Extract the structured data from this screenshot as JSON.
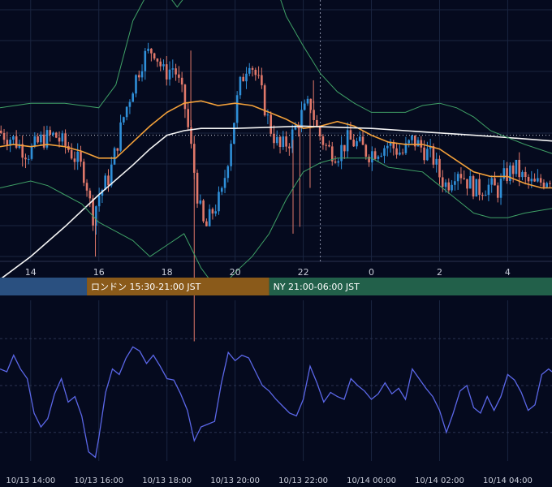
{
  "colors": {
    "background": "#050a1e",
    "grid": "#1a2540",
    "candle_up": "#2f8fd8",
    "candle_down": "#e0786a",
    "sma_short": "#f2a03a",
    "sma_long": "#f4f4f4",
    "bollinger": "#3fa066",
    "oscillator": "#5b67e8",
    "session_tokyo": "#2a5080",
    "session_london": "#8a5a1a",
    "session_ny": "#22604a"
  },
  "chart_data": [
    {
      "type": "candlestick",
      "x_tick_labels": [
        "14",
        "16",
        "18",
        "20",
        "22",
        "0",
        "2",
        "4"
      ],
      "x_tick_hours": [
        14,
        16,
        18,
        20,
        22,
        24,
        26,
        28
      ],
      "xlim_hours": [
        13.1,
        29.3
      ],
      "ylim": [
        0,
        1
      ],
      "grid": true,
      "series": [
        {
          "kind": "sma_short",
          "points": [
            [
              13.1,
              0.43
            ],
            [
              13.5,
              0.44
            ],
            [
              14,
              0.43
            ],
            [
              14.5,
              0.44
            ],
            [
              15,
              0.43
            ],
            [
              15.5,
              0.41
            ],
            [
              16,
              0.38
            ],
            [
              16.5,
              0.38
            ],
            [
              17,
              0.45
            ],
            [
              17.5,
              0.52
            ],
            [
              18,
              0.58
            ],
            [
              18.5,
              0.62
            ],
            [
              19,
              0.63
            ],
            [
              19.5,
              0.61
            ],
            [
              20,
              0.62
            ],
            [
              20.5,
              0.61
            ],
            [
              21,
              0.58
            ],
            [
              21.5,
              0.55
            ],
            [
              22,
              0.51
            ],
            [
              22.5,
              0.52
            ],
            [
              23,
              0.54
            ],
            [
              23.5,
              0.52
            ],
            [
              24,
              0.48
            ],
            [
              24.5,
              0.45
            ],
            [
              25,
              0.44
            ],
            [
              25.5,
              0.44
            ],
            [
              26,
              0.42
            ],
            [
              26.5,
              0.37
            ],
            [
              27,
              0.32
            ],
            [
              27.5,
              0.3
            ],
            [
              28,
              0.3
            ],
            [
              28.5,
              0.27
            ],
            [
              29,
              0.25
            ],
            [
              29.3,
              0.25
            ]
          ]
        },
        {
          "kind": "sma_long",
          "points": [
            [
              13.1,
              -0.15
            ],
            [
              14,
              -0.05
            ],
            [
              15,
              0.08
            ],
            [
              16,
              0.22
            ],
            [
              17,
              0.35
            ],
            [
              17.5,
              0.42
            ],
            [
              18,
              0.48
            ],
            [
              18.5,
              0.5
            ],
            [
              19,
              0.51
            ],
            [
              20,
              0.51
            ],
            [
              21,
              0.515
            ],
            [
              22,
              0.52
            ],
            [
              23,
              0.515
            ],
            [
              24,
              0.51
            ],
            [
              25,
              0.5
            ],
            [
              26,
              0.49
            ],
            [
              27,
              0.48
            ],
            [
              28,
              0.47
            ],
            [
              29.3,
              0.455
            ]
          ]
        },
        {
          "kind": "bollinger_upper",
          "points": [
            [
              13.1,
              0.6
            ],
            [
              14,
              0.62
            ],
            [
              15,
              0.62
            ],
            [
              15.5,
              0.61
            ],
            [
              16,
              0.6
            ],
            [
              16.5,
              0.7
            ],
            [
              17,
              0.98
            ],
            [
              17.5,
              1.12
            ],
            [
              18,
              1.1
            ],
            [
              18.3,
              1.04
            ],
            [
              18.6,
              1.1
            ],
            [
              19,
              1.32
            ],
            [
              19.5,
              1.33
            ],
            [
              20,
              1.25
            ],
            [
              20.5,
              1.3
            ],
            [
              21,
              1.22
            ],
            [
              21.5,
              1.0
            ],
            [
              22,
              0.87
            ],
            [
              22.5,
              0.75
            ],
            [
              23,
              0.67
            ],
            [
              23.5,
              0.62
            ],
            [
              24,
              0.58
            ],
            [
              24.5,
              0.58
            ],
            [
              25,
              0.58
            ],
            [
              25.5,
              0.61
            ],
            [
              26,
              0.62
            ],
            [
              26.5,
              0.6
            ],
            [
              27,
              0.56
            ],
            [
              27.5,
              0.5
            ],
            [
              28,
              0.47
            ],
            [
              28.5,
              0.44
            ],
            [
              29.3,
              0.4
            ]
          ]
        },
        {
          "kind": "bollinger_lower",
          "points": [
            [
              13.1,
              0.25
            ],
            [
              14,
              0.28
            ],
            [
              14.5,
              0.26
            ],
            [
              15,
              0.22
            ],
            [
              15.5,
              0.18
            ],
            [
              16,
              0.1
            ],
            [
              16.5,
              0.06
            ],
            [
              17,
              0.02
            ],
            [
              17.5,
              -0.05
            ],
            [
              18,
              0.0
            ],
            [
              18.5,
              0.05
            ],
            [
              19,
              -0.1
            ],
            [
              19.5,
              -0.2
            ],
            [
              20,
              -0.12
            ],
            [
              20.5,
              -0.05
            ],
            [
              21,
              0.05
            ],
            [
              21.5,
              0.2
            ],
            [
              22,
              0.32
            ],
            [
              22.5,
              0.36
            ],
            [
              23,
              0.38
            ],
            [
              23.5,
              0.38
            ],
            [
              24,
              0.38
            ],
            [
              24.5,
              0.34
            ],
            [
              25,
              0.33
            ],
            [
              25.5,
              0.32
            ],
            [
              26,
              0.26
            ],
            [
              26.5,
              0.2
            ],
            [
              27,
              0.14
            ],
            [
              27.5,
              0.12
            ],
            [
              28,
              0.12
            ],
            [
              28.5,
              0.14
            ],
            [
              29.3,
              0.16
            ]
          ]
        }
      ],
      "price_path": [
        [
          13.1,
          0.5
        ],
        [
          13.6,
          0.46
        ],
        [
          14,
          0.4
        ],
        [
          14.4,
          0.46
        ],
        [
          14.8,
          0.48
        ],
        [
          15.2,
          0.42
        ],
        [
          15.5,
          0.36
        ],
        [
          15.7,
          0.3
        ],
        [
          15.9,
          0.12
        ],
        [
          16.1,
          0.22
        ],
        [
          16.4,
          0.3
        ],
        [
          16.8,
          0.55
        ],
        [
          17.1,
          0.7
        ],
        [
          17.4,
          0.82
        ],
        [
          17.7,
          0.86
        ],
        [
          18,
          0.75
        ],
        [
          18.3,
          0.78
        ],
        [
          18.6,
          0.62
        ],
        [
          18.8,
          0.42
        ],
        [
          19,
          0.2
        ],
        [
          19.2,
          0.06
        ],
        [
          19.4,
          0.14
        ],
        [
          19.7,
          0.22
        ],
        [
          19.9,
          0.4
        ],
        [
          20.2,
          0.68
        ],
        [
          20.5,
          0.82
        ],
        [
          20.8,
          0.7
        ],
        [
          21.1,
          0.52
        ],
        [
          21.4,
          0.42
        ],
        [
          21.7,
          0.46
        ],
        [
          22,
          0.56
        ],
        [
          22.3,
          0.62
        ],
        [
          22.5,
          0.5
        ],
        [
          22.8,
          0.42
        ],
        [
          23.1,
          0.4
        ],
        [
          23.4,
          0.46
        ],
        [
          23.7,
          0.44
        ],
        [
          24,
          0.4
        ],
        [
          24.3,
          0.42
        ],
        [
          24.6,
          0.44
        ],
        [
          25,
          0.4
        ],
        [
          25.3,
          0.46
        ],
        [
          25.6,
          0.42
        ],
        [
          25.9,
          0.38
        ],
        [
          26.1,
          0.3
        ],
        [
          26.3,
          0.26
        ],
        [
          26.6,
          0.34
        ],
        [
          26.9,
          0.28
        ],
        [
          27.2,
          0.24
        ],
        [
          27.5,
          0.26
        ],
        [
          27.8,
          0.24
        ],
        [
          28,
          0.3
        ],
        [
          28.3,
          0.34
        ],
        [
          28.6,
          0.28
        ],
        [
          28.9,
          0.26
        ],
        [
          29.3,
          0.3
        ]
      ],
      "spikes": [
        {
          "x": 15.9,
          "low": -0.05
        },
        {
          "x": 18.7,
          "high": 0.85
        },
        {
          "x": 18.8,
          "low": -0.42
        },
        {
          "x": 21.7,
          "low": 0.05
        },
        {
          "x": 21.9,
          "low": 0.08
        },
        {
          "x": 22.2,
          "low": 0.25
        },
        {
          "x": 22.3,
          "high": 0.72
        }
      ],
      "reference_lines": {
        "dotted_horizontal_y": 0.48,
        "dashed_vertical_x_hours": 22.5
      }
    },
    {
      "type": "line",
      "kind": "oscillator",
      "ylim": [
        0,
        1
      ],
      "x_tick_labels": [
        "10/13 14:00",
        "10/13 16:00",
        "10/13 18:00",
        "10/13 20:00",
        "10/13 22:00",
        "10/14 00:00",
        "10/14 02:00",
        "10/14 04:00"
      ],
      "x_tick_hours": [
        14,
        16,
        18,
        20,
        22,
        24,
        26,
        28
      ],
      "grid_levels": [
        0.16,
        0.5,
        0.84
      ],
      "series": [
        {
          "kind": "oscillator",
          "points": [
            [
              13.1,
              0.62
            ],
            [
              13.3,
              0.6
            ],
            [
              13.5,
              0.72
            ],
            [
              13.7,
              0.62
            ],
            [
              13.9,
              0.55
            ],
            [
              14.1,
              0.3
            ],
            [
              14.3,
              0.2
            ],
            [
              14.5,
              0.26
            ],
            [
              14.7,
              0.44
            ],
            [
              14.9,
              0.55
            ],
            [
              15.1,
              0.38
            ],
            [
              15.3,
              0.42
            ],
            [
              15.5,
              0.28
            ],
            [
              15.7,
              0.02
            ],
            [
              15.9,
              -0.02
            ],
            [
              16.0,
              0.12
            ],
            [
              16.2,
              0.45
            ],
            [
              16.4,
              0.62
            ],
            [
              16.6,
              0.58
            ],
            [
              16.8,
              0.7
            ],
            [
              17.0,
              0.78
            ],
            [
              17.2,
              0.75
            ],
            [
              17.4,
              0.66
            ],
            [
              17.6,
              0.72
            ],
            [
              17.8,
              0.64
            ],
            [
              18.0,
              0.55
            ],
            [
              18.2,
              0.54
            ],
            [
              18.4,
              0.44
            ],
            [
              18.6,
              0.32
            ],
            [
              18.8,
              0.1
            ],
            [
              19.0,
              0.2
            ],
            [
              19.2,
              0.22
            ],
            [
              19.4,
              0.24
            ],
            [
              19.6,
              0.52
            ],
            [
              19.8,
              0.74
            ],
            [
              20.0,
              0.68
            ],
            [
              20.2,
              0.72
            ],
            [
              20.4,
              0.7
            ],
            [
              20.6,
              0.6
            ],
            [
              20.8,
              0.5
            ],
            [
              21.0,
              0.46
            ],
            [
              21.2,
              0.4
            ],
            [
              21.4,
              0.35
            ],
            [
              21.6,
              0.3
            ],
            [
              21.8,
              0.28
            ],
            [
              22.0,
              0.4
            ],
            [
              22.2,
              0.64
            ],
            [
              22.4,
              0.52
            ],
            [
              22.6,
              0.38
            ],
            [
              22.8,
              0.45
            ],
            [
              23.0,
              0.42
            ],
            [
              23.2,
              0.4
            ],
            [
              23.4,
              0.55
            ],
            [
              23.6,
              0.5
            ],
            [
              23.8,
              0.46
            ],
            [
              24.0,
              0.4
            ],
            [
              24.2,
              0.44
            ],
            [
              24.4,
              0.52
            ],
            [
              24.6,
              0.44
            ],
            [
              24.8,
              0.48
            ],
            [
              25.0,
              0.4
            ],
            [
              25.2,
              0.62
            ],
            [
              25.4,
              0.55
            ],
            [
              25.6,
              0.48
            ],
            [
              25.8,
              0.42
            ],
            [
              26.0,
              0.32
            ],
            [
              26.2,
              0.16
            ],
            [
              26.4,
              0.3
            ],
            [
              26.6,
              0.46
            ],
            [
              26.8,
              0.5
            ],
            [
              27.0,
              0.34
            ],
            [
              27.2,
              0.3
            ],
            [
              27.4,
              0.42
            ],
            [
              27.6,
              0.32
            ],
            [
              27.8,
              0.42
            ],
            [
              28.0,
              0.58
            ],
            [
              28.2,
              0.54
            ],
            [
              28.4,
              0.45
            ],
            [
              28.6,
              0.32
            ],
            [
              28.8,
              0.36
            ],
            [
              29.0,
              0.58
            ],
            [
              29.2,
              0.62
            ],
            [
              29.3,
              0.6
            ]
          ]
        }
      ]
    }
  ],
  "sessions": [
    {
      "label": "",
      "start_hours": 13.1,
      "end_hours": 15.65,
      "color_key": "session_tokyo"
    },
    {
      "label": "ロンドン 15:30-21:00 JST",
      "start_hours": 15.65,
      "end_hours": 21.0,
      "color_key": "session_london"
    },
    {
      "label": "NY 21:00-06:00 JST",
      "start_hours": 21.0,
      "end_hours": 29.3,
      "color_key": "session_ny"
    }
  ]
}
